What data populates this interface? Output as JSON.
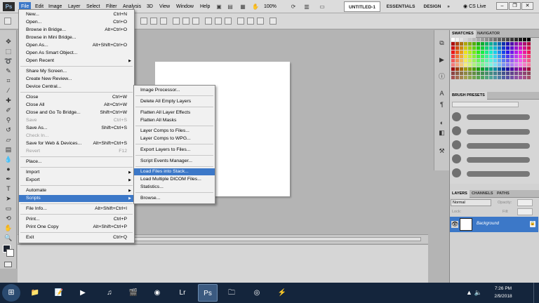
{
  "app": {
    "logo": "Ps"
  },
  "menubar": {
    "items": [
      "File",
      "Edit",
      "Image",
      "Layer",
      "Select",
      "Filter",
      "Analysis",
      "3D",
      "View",
      "Window",
      "Help"
    ],
    "zoom": "100%",
    "workspaces": {
      "current": "UNTITLED-1",
      "essentials": "ESSENTIALS",
      "design": "DESIGN",
      "more": "»"
    },
    "cs_live": "CS Live"
  },
  "file_menu": {
    "items": [
      {
        "label": "New...",
        "shortcut": "Ctrl+N"
      },
      {
        "label": "Open...",
        "shortcut": "Ctrl+O"
      },
      {
        "label": "Browse in Bridge...",
        "shortcut": "Alt+Ctrl+O"
      },
      {
        "label": "Browse in Mini Bridge...",
        "shortcut": ""
      },
      {
        "label": "Open As...",
        "shortcut": "Alt+Shift+Ctrl+O"
      },
      {
        "label": "Open As Smart Object...",
        "shortcut": ""
      },
      {
        "label": "Open Recent",
        "shortcut": ""
      },
      {
        "label": "Share My Screen...",
        "shortcut": ""
      },
      {
        "label": "Create New Review...",
        "shortcut": ""
      },
      {
        "label": "Device Central...",
        "shortcut": ""
      },
      {
        "label": "Close",
        "shortcut": "Ctrl+W"
      },
      {
        "label": "Close All",
        "shortcut": "Alt+Ctrl+W"
      },
      {
        "label": "Close and Go To Bridge...",
        "shortcut": "Shift+Ctrl+W"
      },
      {
        "label": "Save",
        "shortcut": "Ctrl+S"
      },
      {
        "label": "Save As...",
        "shortcut": "Shift+Ctrl+S"
      },
      {
        "label": "Check In...",
        "shortcut": ""
      },
      {
        "label": "Save for Web & Devices...",
        "shortcut": "Alt+Shift+Ctrl+S"
      },
      {
        "label": "Revert",
        "shortcut": "F12"
      },
      {
        "label": "Place...",
        "shortcut": ""
      },
      {
        "label": "Import",
        "shortcut": ""
      },
      {
        "label": "Export",
        "shortcut": ""
      },
      {
        "label": "Automate",
        "shortcut": ""
      },
      {
        "label": "Scripts",
        "shortcut": ""
      },
      {
        "label": "File Info...",
        "shortcut": "Alt+Shift+Ctrl+I"
      },
      {
        "label": "Print...",
        "shortcut": "Ctrl+P"
      },
      {
        "label": "Print One Copy",
        "shortcut": "Alt+Shift+Ctrl+P"
      },
      {
        "label": "Exit",
        "shortcut": "Ctrl+Q"
      }
    ]
  },
  "scripts_menu": {
    "items": [
      "Image Processor...",
      "Delete All Empty Layers",
      "Flatten All Layer Effects",
      "Flatten All Masks",
      "Layer Comps to Files...",
      "Layer Comps to WPG...",
      "Export Layers to Files...",
      "Script Events Manager...",
      "Load Files into Stack...",
      "Load Multiple DICOM Files...",
      "Statistics...",
      "Browse..."
    ]
  },
  "panels": {
    "swatches_tab": "SWATCHES",
    "navigator_tab": "NAVIGATOR",
    "brush_presets_tab": "BRUSH PRESETS",
    "layers_tab": "LAYERS",
    "channels_tab": "CHANNELS",
    "paths_tab": "PATHS",
    "blend_mode": "Normal",
    "opacity_label": "Opacity:",
    "lock_label": "Lock:",
    "fill_label": "Fill:",
    "layer_name": "Background"
  },
  "taskbar": {
    "apps": [
      "explorer-icon",
      "notepad-icon",
      "media-player-icon",
      "itunes-icon",
      "video-icon",
      "media-center-icon",
      "lightroom-icon",
      "photoshop-icon",
      "folder-icon",
      "chrome-icon",
      "extension-icon"
    ],
    "lightroom_label": "Lr",
    "photoshop_label": "Ps",
    "time": "7:26 PM",
    "date": "2/9/2018"
  }
}
